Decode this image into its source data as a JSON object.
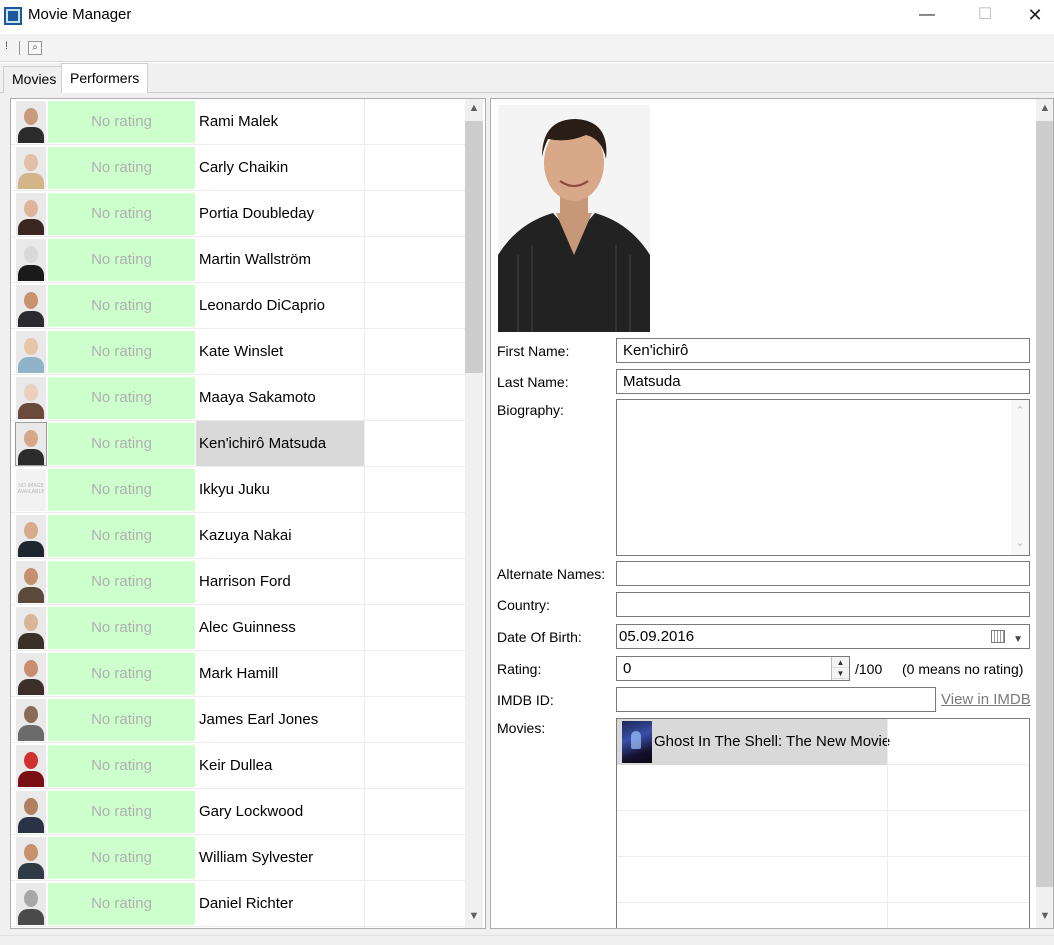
{
  "window": {
    "title": "Movie Manager",
    "minimize": "—",
    "maximize": "☐",
    "close": "✕"
  },
  "toolbar": {
    "exclaim": "!",
    "search": "⌕"
  },
  "tabs": [
    {
      "label": "Movies"
    },
    {
      "label": "Performers"
    }
  ],
  "performers": [
    {
      "rating": "No rating",
      "name": "Rami Malek",
      "skin": "#c99a7c",
      "shirt": "#2b2b2b"
    },
    {
      "rating": "No rating",
      "name": "Carly Chaikin",
      "skin": "#e2bfa6",
      "shirt": "#d4b58a"
    },
    {
      "rating": "No rating",
      "name": "Portia Doubleday",
      "skin": "#e0b49a",
      "shirt": "#3a2620"
    },
    {
      "rating": "No rating",
      "name": "Martin Wallström",
      "skin": "#d9d9d9",
      "shirt": "#1a1a1a"
    },
    {
      "rating": "No rating",
      "name": "Leonardo DiCaprio",
      "skin": "#c9926f",
      "shirt": "#2a2a30"
    },
    {
      "rating": "No rating",
      "name": "Kate Winslet",
      "skin": "#e8c7a8",
      "shirt": "#8fb3c9"
    },
    {
      "rating": "No rating",
      "name": "Maaya Sakamoto",
      "skin": "#ead0bd",
      "shirt": "#6a4a3a"
    },
    {
      "rating": "No rating",
      "name": "Ken'ichirô Matsuda",
      "skin": "#d6a888",
      "shirt": "#2c2c2c"
    },
    {
      "rating": "No rating",
      "name": "Ikkyu Juku",
      "noimage": "NO IMAGE AVAILABLE"
    },
    {
      "rating": "No rating",
      "name": "Kazuya Nakai",
      "skin": "#d8a98a",
      "shirt": "#1e2630"
    },
    {
      "rating": "No rating",
      "name": "Harrison Ford",
      "skin": "#c58f70",
      "shirt": "#5a4a3c"
    },
    {
      "rating": "No rating",
      "name": "Alec Guinness",
      "skin": "#d9b59a",
      "shirt": "#3a3028"
    },
    {
      "rating": "No rating",
      "name": "Mark Hamill",
      "skin": "#c98d6f",
      "shirt": "#3c2f2a"
    },
    {
      "rating": "No rating",
      "name": "James Earl Jones",
      "skin": "#8a6a58",
      "shirt": "#6b6b6b"
    },
    {
      "rating": "No rating",
      "name": "Keir Dullea",
      "skin": "#d23030",
      "shirt": "#7a1010"
    },
    {
      "rating": "No rating",
      "name": "Gary Lockwood",
      "skin": "#b08060",
      "shirt": "#2a3345"
    },
    {
      "rating": "No rating",
      "name": "William Sylvester",
      "skin": "#c8906c",
      "shirt": "#2f3a44"
    },
    {
      "rating": "No rating",
      "name": "Daniel Richter",
      "skin": "#a8a8a8",
      "shirt": "#4a4a4a"
    }
  ],
  "selected_performer": 7,
  "detail": {
    "first_name_label": "First Name:",
    "first_name": "Ken'ichirô",
    "last_name_label": "Last Name:",
    "last_name": "Matsuda",
    "biography_label": "Biography:",
    "biography": "",
    "alternate_names_label": "Alternate Names:",
    "alternate_names": "",
    "country_label": "Country:",
    "country": "",
    "dob_label": "Date Of Birth:",
    "dob": "05.09.2016",
    "rating_label": "Rating:",
    "rating": "0",
    "rating_suffix": "/100",
    "rating_hint": "(0 means no rating)",
    "imdb_label": "IMDB ID:",
    "imdb_id": "",
    "view_imdb": "View in IMDB",
    "movies_label": "Movies:",
    "movies": [
      {
        "title": "Ghost In The Shell: The New Movie"
      }
    ]
  },
  "colors": {
    "rating_cell": "#ccffcc",
    "rating_text": "#b0b0b0",
    "selection": "#d9d9d9",
    "link": "#7a7a7a"
  }
}
